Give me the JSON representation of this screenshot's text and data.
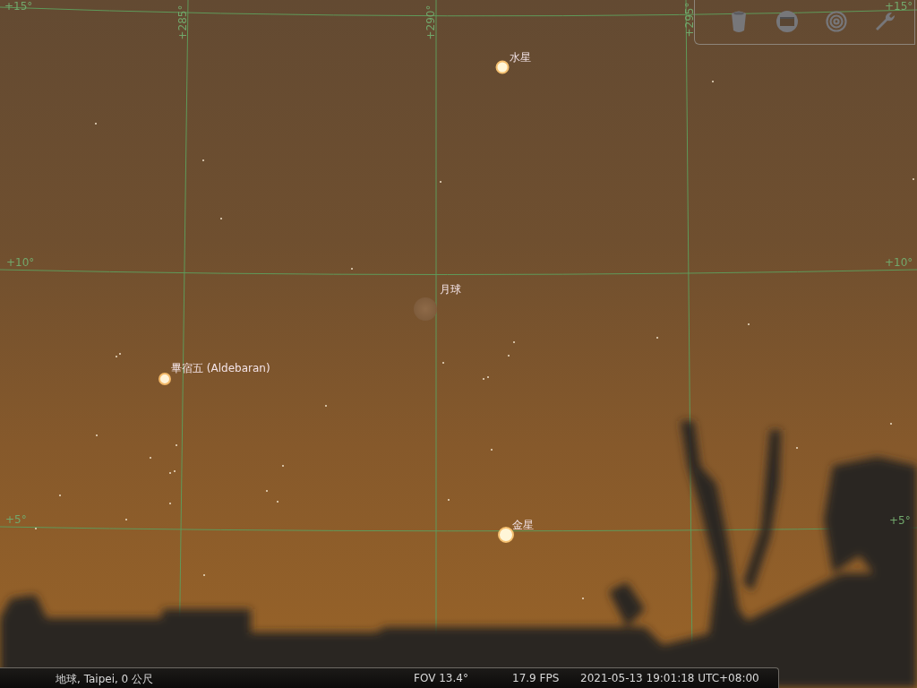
{
  "sky": {
    "grid_labels": [
      {
        "kind": "dec",
        "text": "+15°"
      },
      {
        "kind": "ra",
        "text": "+285°"
      },
      {
        "kind": "ra",
        "text": "+290°"
      },
      {
        "kind": "ra",
        "text": "+295°"
      },
      {
        "kind": "dec",
        "text": "+15°"
      },
      {
        "kind": "dec",
        "text": "+10°"
      },
      {
        "kind": "dec",
        "text": "+10°"
      },
      {
        "kind": "dec",
        "text": "+5°"
      },
      {
        "kind": "dec",
        "text": "+5°"
      }
    ],
    "objects": [
      {
        "kind": "planet",
        "label": "水星"
      },
      {
        "kind": "moon",
        "label": "月球"
      },
      {
        "kind": "star",
        "label": "畢宿五 (Aldebaran)"
      },
      {
        "kind": "planet",
        "label": "金星"
      }
    ]
  },
  "status_bar": {
    "location": "地球, Taipei, 0 公尺",
    "fov": "FOV 13.4°",
    "fps": "17.9 FPS",
    "datetime": "2021-05-13 19:01:18 UTC+08:00"
  }
}
